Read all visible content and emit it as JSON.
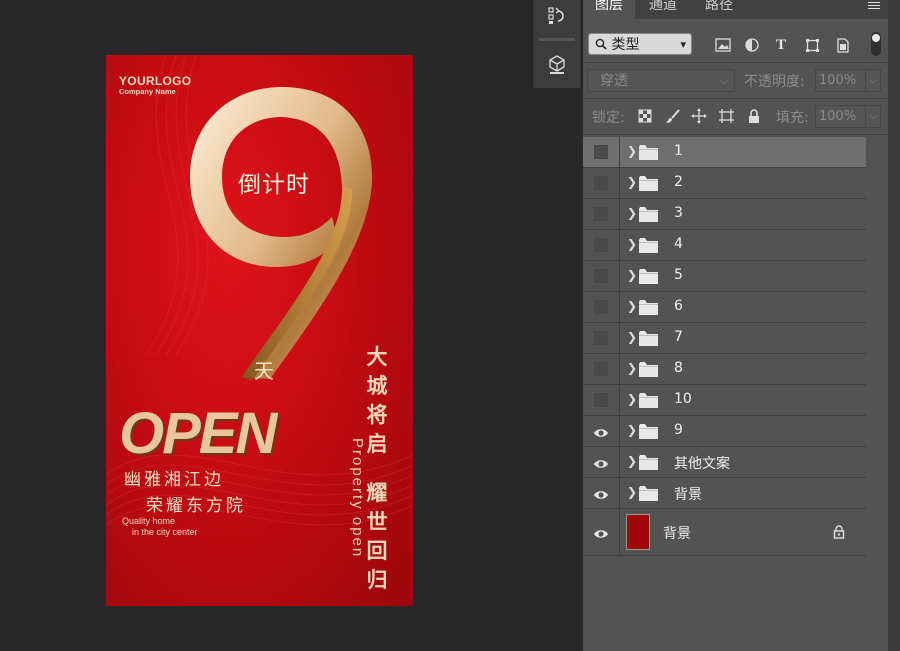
{
  "poster": {
    "logo_line1": "YOURLOGO",
    "logo_line2": "Company Name",
    "countdown_text": "倒计时",
    "day_text": "天",
    "open_text": "OPEN",
    "subtitle_line1": "幽雅湘江边",
    "subtitle_line2": "荣耀东方院",
    "tagline_line1": "Quality home",
    "tagline_line2": "in the city center",
    "vertical_col1": "大城将启",
    "vertical_col2": "耀世回归",
    "vertical_english": "Property open",
    "colors": {
      "background": "#c40b12",
      "gold": "#e9c79e"
    }
  },
  "toolstrip": {
    "icons": [
      "history-icon",
      "3d-cube-icon"
    ]
  },
  "panel": {
    "tabs": [
      {
        "label": "图层",
        "active": true
      },
      {
        "label": "通道",
        "active": false
      },
      {
        "label": "路径",
        "active": false
      }
    ],
    "filter_label": "类型",
    "filter_icons": [
      "image-filter-icon",
      "adjustment-filter-icon",
      "text-filter-icon",
      "shape-filter-icon",
      "smart-object-filter-icon"
    ],
    "blend_mode": "穿透",
    "opacity_label": "不透明度:",
    "opacity_value": "100%",
    "lock_label": "锁定:",
    "fill_label": "填充:",
    "fill_value": "100%",
    "layers": [
      {
        "name": "1",
        "visible": false,
        "selected": true
      },
      {
        "name": "2",
        "visible": false
      },
      {
        "name": "3",
        "visible": false
      },
      {
        "name": "4",
        "visible": false
      },
      {
        "name": "5",
        "visible": false
      },
      {
        "name": "6",
        "visible": false
      },
      {
        "name": "7",
        "visible": false
      },
      {
        "name": "8",
        "visible": false
      },
      {
        "name": "10",
        "visible": false
      },
      {
        "name": "9",
        "visible": true
      },
      {
        "name": "其他文案",
        "visible": true
      },
      {
        "name": "背景",
        "visible": true
      }
    ],
    "background_layer": {
      "name": "背景",
      "visible": true,
      "locked": true,
      "thumbnail_color": "#a2050a"
    }
  }
}
